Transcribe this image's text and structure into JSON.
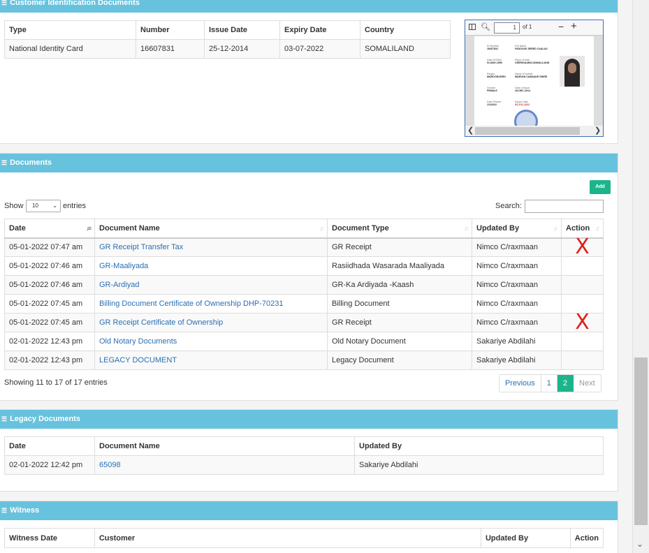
{
  "customer_docs": {
    "title": "Customer Identification Documents",
    "headers": [
      "Type",
      "Number",
      "Issue Date",
      "Expiry Date",
      "Country"
    ],
    "rows": [
      [
        "National Identity Card",
        "16607831",
        "25-12-2014",
        "03-07-2022",
        "SOMALILAND"
      ]
    ],
    "pdf": {
      "page_value": "1",
      "page_of": "of 1",
      "zoom_out": "−",
      "zoom_in": "+",
      "fields": [
        {
          "label": "ID Number",
          "value": "16607831"
        },
        {
          "label": "Full Name",
          "value": "FADOUUS SEEED CAALAX"
        },
        {
          "label": "Date Of Birth",
          "value": "01-MAY-1990"
        },
        {
          "label": "Place of birth",
          "value": "CEERIGAABO,SOMALILAND"
        },
        {
          "label": "Region",
          "value": "MAROODIJEEH"
        },
        {
          "label": "Name of mother",
          "value": "MARYAN CABAADE SHIRE"
        },
        {
          "label": "Gender",
          "value": "FEMALE"
        },
        {
          "label": "Date of issue",
          "value": "25-DEC-2014"
        },
        {
          "label": "Date Printed",
          "value": "1/1/2022"
        },
        {
          "label": "Expiry Date",
          "value": "03-JUL-2022"
        }
      ]
    }
  },
  "documents": {
    "title": "Documents",
    "add_label": "Add",
    "show_label": "Show",
    "page_size": "10",
    "entries_label": "entries",
    "search_label": "Search:",
    "headers": [
      "Date",
      "Document Name",
      "Document Type",
      "Updated By",
      "Action"
    ],
    "rows": [
      {
        "date": "05-01-2022 07:47 am",
        "name": "GR Receipt Transfer Tax",
        "type": "GR Receipt",
        "by": "Nimco C/raxmaan",
        "action": "X"
      },
      {
        "date": "05-01-2022 07:46 am",
        "name": "GR-Maaliyada",
        "type": "Rasiidhada Wasarada Maaliyada",
        "by": "Nimco C/raxmaan",
        "action": ""
      },
      {
        "date": "05-01-2022 07:46 am",
        "name": "GR-Ardiyad",
        "type": "GR-Ka Ardiyada -Kaash",
        "by": "Nimco C/raxmaan",
        "action": ""
      },
      {
        "date": "05-01-2022 07:45 am",
        "name": "Billing Document Certificate of Ownership DHP-70231",
        "type": "Billing Document",
        "by": "Nimco C/raxmaan",
        "action": ""
      },
      {
        "date": "05-01-2022 07:45 am",
        "name": "GR Receipt Certificate of Ownership",
        "type": "GR Receipt",
        "by": "Nimco C/raxmaan",
        "action": "X"
      },
      {
        "date": "02-01-2022 12:43 pm",
        "name": "Old Notary Documents",
        "type": "Old Notary Document",
        "by": "Sakariye Abdilahi",
        "action": ""
      },
      {
        "date": "02-01-2022 12:43 pm",
        "name": "LEGACY DOCUMENT",
        "type": "Legacy Document",
        "by": "Sakariye Abdilahi",
        "action": ""
      }
    ],
    "info": "Showing 11 to 17 of 17 entries",
    "pager": {
      "previous": "Previous",
      "p1": "1",
      "p2": "2",
      "next": "Next"
    }
  },
  "legacy": {
    "title": "Legacy Documents",
    "headers": [
      "Date",
      "Document Name",
      "Updated By"
    ],
    "rows": [
      {
        "date": "02-01-2022 12:42 pm",
        "name": "65098",
        "by": "Sakariye Abdilahi"
      }
    ]
  },
  "witness": {
    "title": "Witness",
    "headers": [
      "Witness Date",
      "Customer",
      "Updated By",
      "Action"
    ]
  },
  "colors": {
    "panel_header": "#67c2de",
    "accent_green": "#1cb58b",
    "link": "#2a6fb3",
    "mark_red": "#e0201c"
  }
}
